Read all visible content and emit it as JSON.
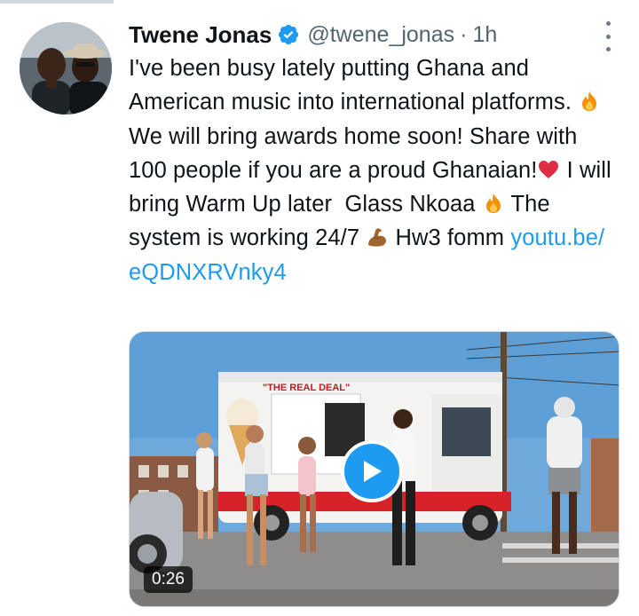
{
  "tweet": {
    "author_name": "Twene Jonas",
    "handle": "@twene_jonas",
    "separator": "·",
    "time": "1h",
    "text_parts": {
      "p1": "I've been busy lately putting Ghana and American music into international platforms. ",
      "p2": " We will bring awards home soon! Share with 100 people if you are a proud Ghanaian!",
      "p3": " I will bring Warm Up later  Glass Nkoaa ",
      "p4": " The system is working 24/7 ",
      "p5": " Hw3 fomm ",
      "link": "youtu.be/\neQDNXRVnky4"
    },
    "emojis": [
      "fire-emoji",
      "heart-emoji",
      "fire-emoji",
      "flexed-biceps-emoji"
    ]
  },
  "media": {
    "truck_sign": "\"THE REAL DEAL\"",
    "duration": "0:26",
    "play_icon": "play-icon"
  },
  "colors": {
    "link": "#1d9bf0",
    "secondary_text": "#536471",
    "play_button": "#1d9bf0"
  }
}
